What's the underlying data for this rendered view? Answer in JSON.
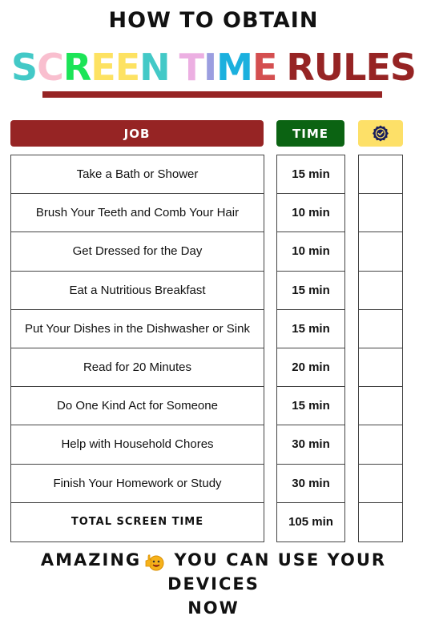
{
  "heading": "HOW TO OBTAIN",
  "title": {
    "letters": [
      {
        "char": "S",
        "color": "#43c9c7"
      },
      {
        "char": "C",
        "color": "#f9bfcf"
      },
      {
        "char": "R",
        "color": "#1ce457"
      },
      {
        "char": "E",
        "color": "#fde262"
      },
      {
        "char": "E",
        "color": "#fde262"
      },
      {
        "char": "N",
        "color": "#43c9c7"
      },
      {
        "char": " ",
        "color": "#ffffff"
      },
      {
        "char": "T",
        "color": "#ecafe2"
      },
      {
        "char": "I",
        "color": "#9b9ee0"
      },
      {
        "char": "M",
        "color": "#1bb0de"
      },
      {
        "char": "E",
        "color": "#d44f50"
      },
      {
        "char": " ",
        "color": "#ffffff"
      },
      {
        "char": "R",
        "color": "#962424"
      },
      {
        "char": "U",
        "color": "#962424"
      },
      {
        "char": "L",
        "color": "#962424"
      },
      {
        "char": "E",
        "color": "#962424"
      },
      {
        "char": "S",
        "color": "#962424"
      }
    ]
  },
  "headers": {
    "job": "JOB",
    "time": "TIME",
    "check_icon": "verified-badge-icon"
  },
  "colors": {
    "job_header": "#962424",
    "time_header": "#0b6312",
    "check_header": "#fde068",
    "badge": "#1a1f5c"
  },
  "rows": [
    {
      "job": "Take a Bath or Shower",
      "time": "15 min"
    },
    {
      "job": "Brush Your Teeth and Comb Your Hair",
      "time": "10 min"
    },
    {
      "job": "Get Dressed for the Day",
      "time": "10 min"
    },
    {
      "job": "Eat a Nutritious Breakfast",
      "time": "15 min"
    },
    {
      "job": "Put Your Dishes in the Dishwasher or Sink",
      "time": "15 min"
    },
    {
      "job": "Read for 20 Minutes",
      "time": "20 min"
    },
    {
      "job": "Do One Kind Act for Someone",
      "time": "15 min"
    },
    {
      "job": "Help with Household Chores",
      "time": "30 min"
    },
    {
      "job": "Finish Your Homework or Study",
      "time": "30 min"
    }
  ],
  "total": {
    "label": "TOTAL SCREEN TIME",
    "time": "105 min"
  },
  "footer": {
    "before": "AMAZING",
    "icon": "thumbs-up-smiley-icon",
    "after": "YOU CAN USE YOUR DEVICES",
    "line2": "NOW"
  }
}
